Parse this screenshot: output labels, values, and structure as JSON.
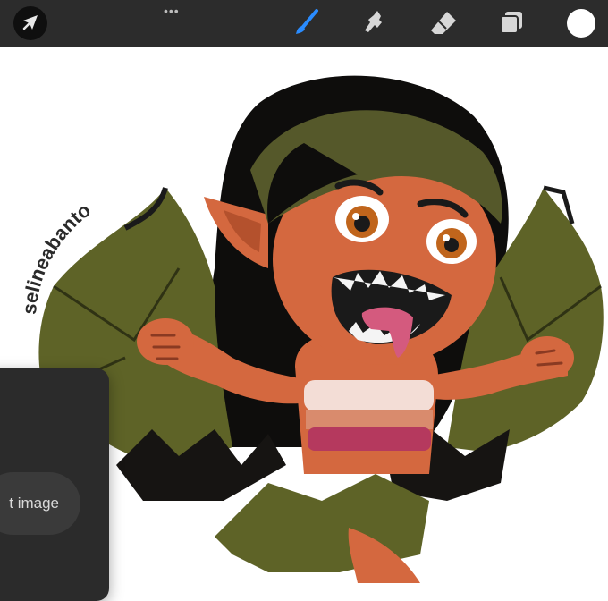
{
  "toolbar": {
    "more_label": "•••",
    "icons": [
      "actions-icon",
      "brush-icon",
      "smudge-icon",
      "eraser-icon",
      "layers-icon",
      "color-swatch"
    ],
    "active_tool": "brush",
    "accent_color": "#2a8cff",
    "current_color": "#ffffff"
  },
  "canvas": {
    "watermark": "selineabanto"
  },
  "panel": {
    "button_label": "t image"
  }
}
